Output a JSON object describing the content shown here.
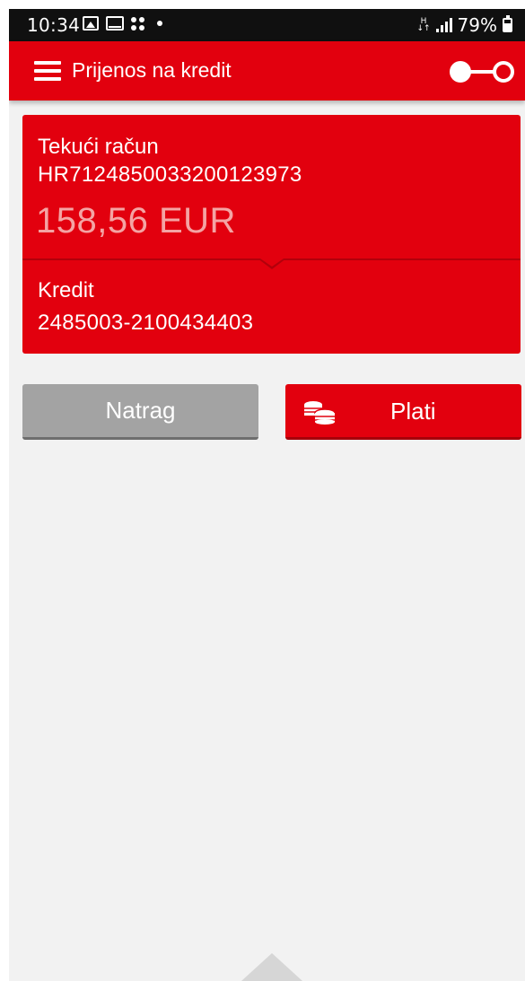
{
  "status_bar": {
    "time": "10:34",
    "network_label": "H",
    "battery": "79%"
  },
  "app_bar": {
    "title": "Prijenos na kredit",
    "accent_color": "#e2000e"
  },
  "transfer": {
    "from_account_label": "Tekući račun",
    "from_account_iban": "HR7124850033200123973",
    "balance": "158,56 EUR",
    "to_label": "Kredit",
    "to_number": "2485003-2100434403"
  },
  "actions": {
    "back_label": "Natrag",
    "pay_label": "Plati"
  },
  "icons": [
    "menu-icon",
    "toggle-icon",
    "coins-icon",
    "chevron-up-icon"
  ]
}
